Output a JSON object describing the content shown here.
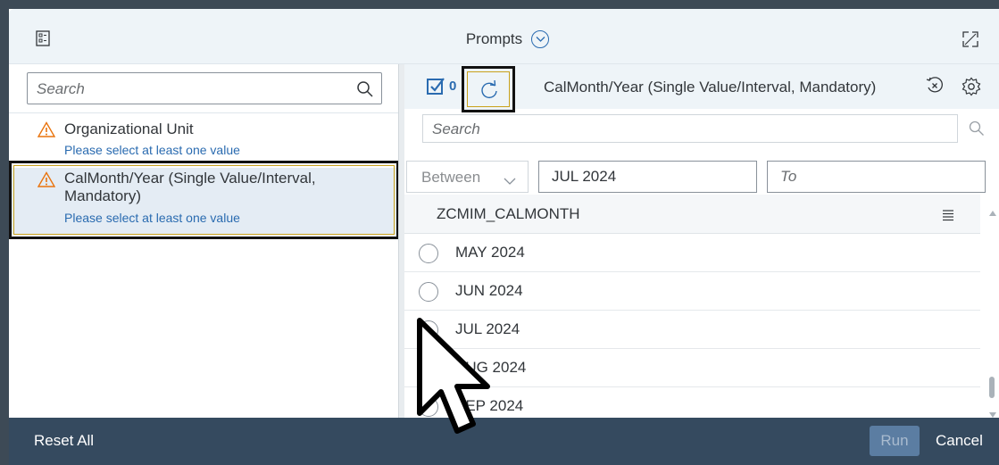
{
  "dialog": {
    "title": "Prompts",
    "icons": {
      "left": "prompts-list-icon",
      "title_toggle": "chevron-down-circle-icon",
      "right": "fullscreen-icon"
    }
  },
  "left_panel": {
    "search_placeholder": "Search",
    "items": [
      {
        "label": "Organizational Unit",
        "subtext": "Please select at least one value",
        "icon": "warning-icon"
      },
      {
        "label": "CalMonth/Year (Single Value/Interval, Mandatory)",
        "subtext": "Please select at least one value",
        "icon": "warning-icon",
        "selected": true
      }
    ]
  },
  "right_panel": {
    "selected_count": "0",
    "title": "CalMonth/Year (Single Value/Interval, Mandatory)",
    "search_placeholder": "Search",
    "operator": "Between",
    "from_value": "JUL 2024",
    "to_placeholder": "To",
    "column_header": "ZCMIM_CALMONTH",
    "rows": [
      "MAY 2024",
      "JUN 2024",
      "JUL 2024",
      "AUG 2024",
      "SEP 2024"
    ]
  },
  "footer": {
    "reset_label": "Reset All",
    "run_label": "Run",
    "cancel_label": "Cancel"
  },
  "colors": {
    "header_bg": "#eef4f8",
    "footer_bg": "#354a5f",
    "accent": "#2a6bb0",
    "warning": "#e9730c",
    "selected_bg": "#e4ecf4"
  }
}
